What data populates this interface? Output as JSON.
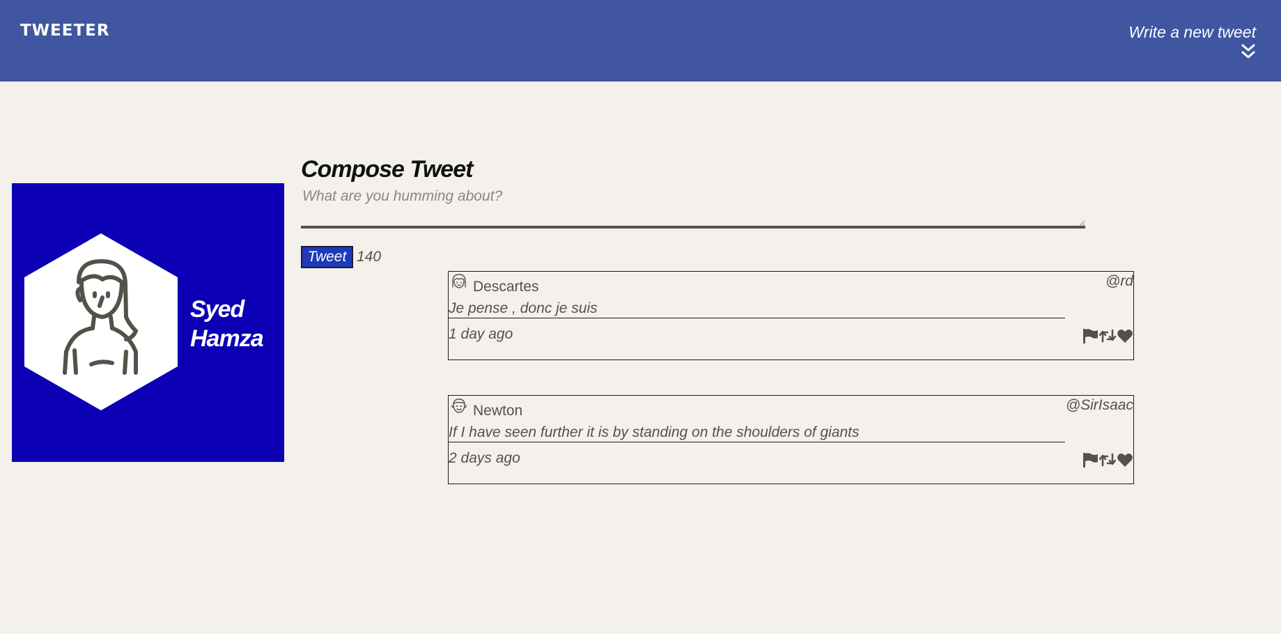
{
  "nav": {
    "brand": "TWEETER",
    "compose_label": "Write a new tweet",
    "compose_icon": "double-chevron-down-icon",
    "background": "#4056a1"
  },
  "profile": {
    "name": "Syed Hamza",
    "avatar_icon": "female-avatar-icon",
    "background": "#0b00b4"
  },
  "compose": {
    "title": "Compose Tweet",
    "placeholder": "What are you humming about?",
    "value": "",
    "button_label": "Tweet",
    "counter": "140"
  },
  "tweets": [
    {
      "name": "Descartes",
      "handle": "@rd",
      "text": "Je pense , donc je suis",
      "time": "1 day ago",
      "avatar_icon": "female-avatar-icon"
    },
    {
      "name": "Newton",
      "handle": "@SirIsaac",
      "text": "If I have seen further it is by standing on the shoulders of giants",
      "time": "2 days ago",
      "avatar_icon": "male-avatar-icon"
    }
  ],
  "tweet_action_icons": [
    "flag-icon",
    "retweet-icon",
    "heart-icon"
  ]
}
